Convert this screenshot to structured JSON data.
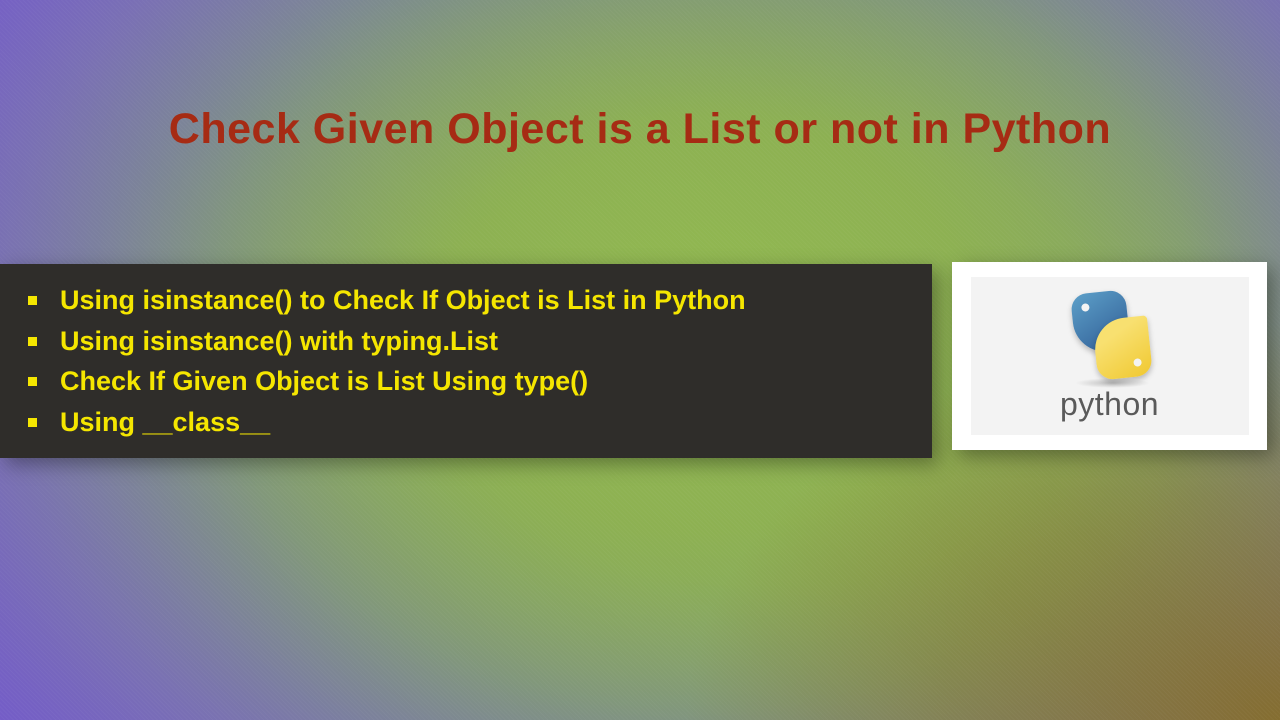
{
  "title": "Check Given Object is a List or not in Python",
  "bullets": [
    "Using isinstance() to Check If Object is List in Python",
    "Using isinstance() with typing.List",
    "Check If Given Object is List Using type()",
    "Using __class__"
  ],
  "logo": {
    "text": "python"
  }
}
